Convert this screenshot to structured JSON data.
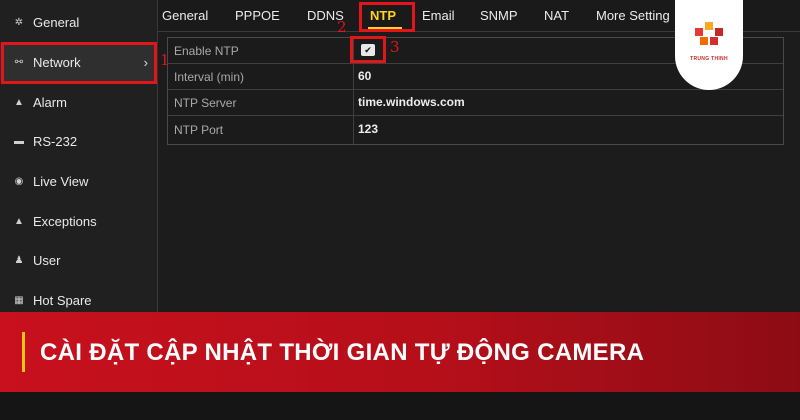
{
  "sidebar": {
    "items": [
      {
        "label": "General",
        "icon": "gear-icon"
      },
      {
        "label": "Network",
        "icon": "network-icon"
      },
      {
        "label": "Alarm",
        "icon": "alarm-icon"
      },
      {
        "label": "RS-232",
        "icon": "serial-port-icon"
      },
      {
        "label": "Live View",
        "icon": "eye-icon"
      },
      {
        "label": "Exceptions",
        "icon": "warning-icon"
      },
      {
        "label": "User",
        "icon": "user-icon"
      },
      {
        "label": "Hot Spare",
        "icon": "hot-spare-icon"
      }
    ]
  },
  "tabs": [
    "General",
    "PPPOE",
    "DDNS",
    "NTP",
    "Email",
    "SNMP",
    "NAT",
    "More Setting"
  ],
  "active_tab": "NTP",
  "ntp": {
    "enable_label": "Enable NTP",
    "enabled": true,
    "interval_label": "Interval (min)",
    "interval_value": "60",
    "server_label": "NTP Server",
    "server_value": "time.windows.com",
    "port_label": "NTP Port",
    "port_value": "123"
  },
  "annotations": [
    "1",
    "2",
    "3"
  ],
  "logo": {
    "text": "TRUNG THINH"
  },
  "banner": {
    "title": "CÀI ĐẶT CẬP NHẬT THỜI GIAN TỰ ĐỘNG CAMERA"
  },
  "colors": {
    "accent_yellow": "#ffd21f",
    "annotation_red": "#e1161b",
    "banner_red": "#c8101e"
  }
}
